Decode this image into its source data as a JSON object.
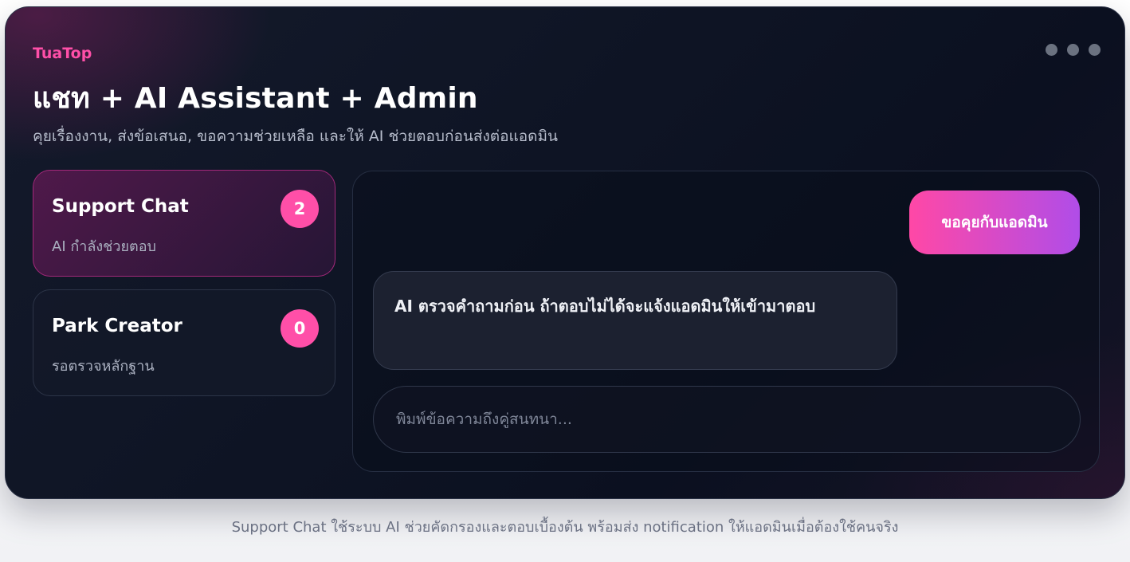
{
  "brand": "TuaTop",
  "header": {
    "title": "แชท + AI Assistant + Admin",
    "subtitle": "คุยเรื่องงาน, ส่งข้อเสนอ, ขอความช่วยเหลือ และให้ AI ช่วยตอบก่อนส่งต่อแอดมิน"
  },
  "conversations": [
    {
      "name": "Support Chat",
      "status": "AI กำลังช่วยตอบ",
      "unread": "2",
      "active": true
    },
    {
      "name": "Park Creator",
      "status": "รอตรวจหลักฐาน",
      "unread": "0",
      "active": false
    }
  ],
  "chat": {
    "admin_button_label": "ขอคุยกับแอดมิน",
    "ai_message": "AI ตรวจคำถามก่อน ถ้าตอบไม่ได้จะแจ้งแอดมินให้เข้ามาตอบ",
    "input_placeholder": "พิมพ์ข้อความถึงคู่สนทนา..."
  },
  "caption": "Support Chat ใช้ระบบ AI ช่วยคัดกรองและตอบเบื้องต้น พร้อมส่ง notification ให้แอดมินเมื่อต้องใช้คนจริง",
  "colors": {
    "accent": "#ff4fa8",
    "gradient_start": "#ff48a6",
    "gradient_end": "#b04de8",
    "card_bg": "#0e1424"
  },
  "icons": [
    "more-dots-icon"
  ]
}
